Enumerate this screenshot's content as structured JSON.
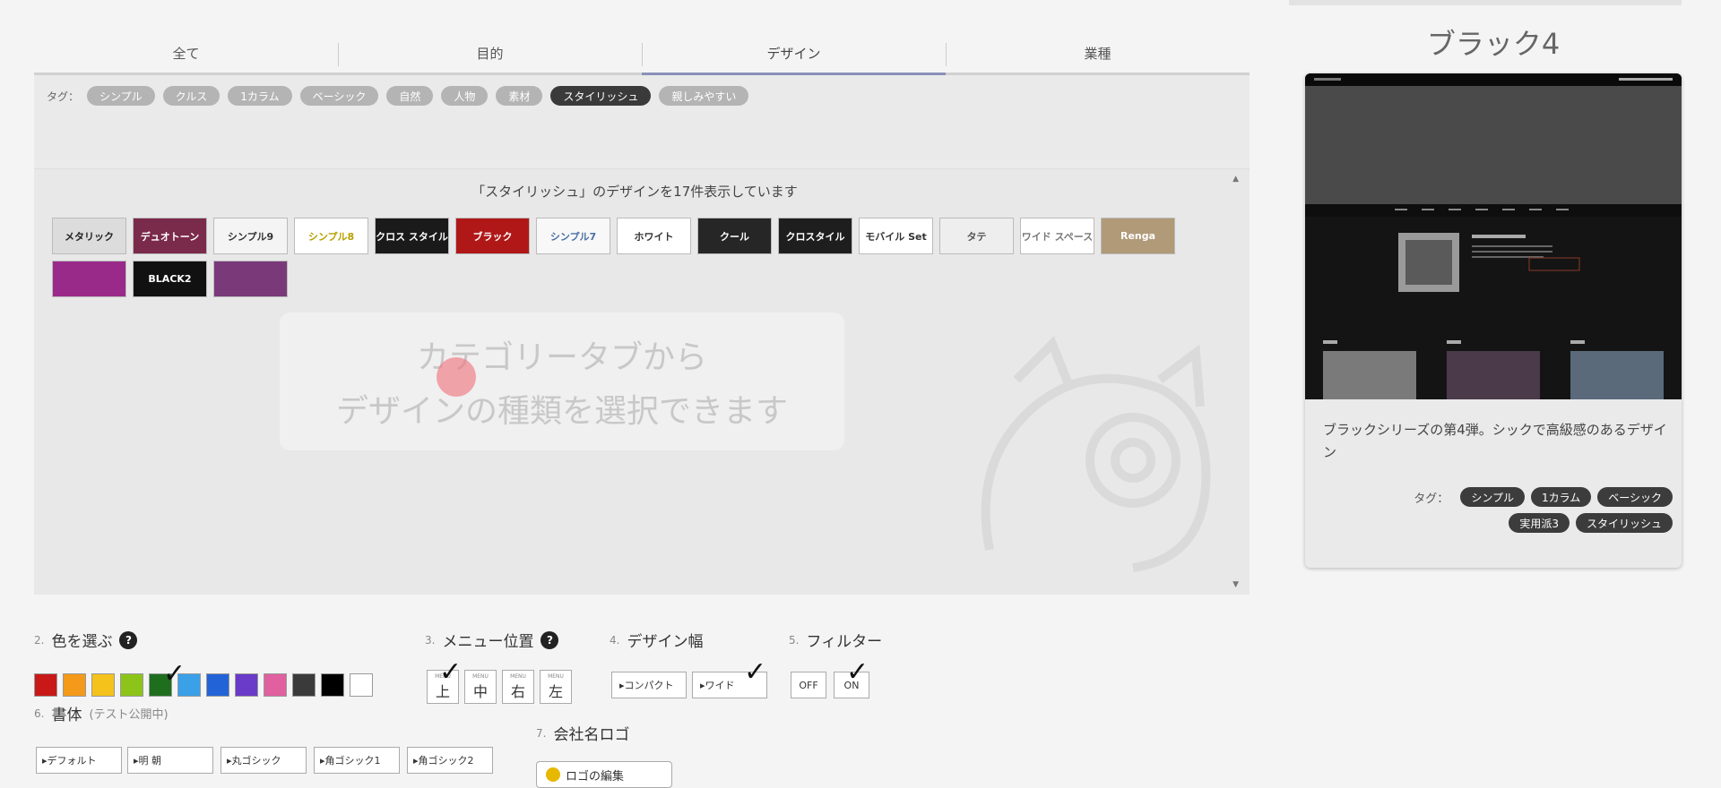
{
  "tabs": [
    {
      "label": "全て"
    },
    {
      "label": "目的"
    },
    {
      "label": "デザイン"
    },
    {
      "label": "業種"
    }
  ],
  "tagbar": {
    "label": "タグ：",
    "tags": [
      "シンプル",
      "クルス",
      "1カラム",
      "ベーシック",
      "自然",
      "人物",
      "素材",
      "スタイリッシュ",
      "親しみやすい"
    ],
    "active": "スタイリッシュ"
  },
  "gallery": {
    "count_text": "「スタイリッシュ」のデザインを17件表示しています",
    "thumbnails": [
      {
        "label": "メタリック",
        "bg": "#dcdcdc",
        "fg": "#222"
      },
      {
        "label": "デュオトーン",
        "bg": "#7a2a4a",
        "fg": "#fff"
      },
      {
        "label": "シンプル9",
        "bg": "#f4f4f4",
        "fg": "#333"
      },
      {
        "label": "シンプル8",
        "bg": "#ffffff",
        "fg": "#b8a000"
      },
      {
        "label": "クロス スタイル",
        "bg": "#1a1a1a",
        "fg": "#fff"
      },
      {
        "label": "ブラック",
        "bg": "#b01818",
        "fg": "#fff"
      },
      {
        "label": "シンプル7",
        "bg": "#f8f8f8",
        "fg": "#4a6fa5"
      },
      {
        "label": "ホワイト",
        "bg": "#ffffff",
        "fg": "#333"
      },
      {
        "label": "クール",
        "bg": "#262626",
        "fg": "#fff"
      },
      {
        "label": "クロスタイル",
        "bg": "#1e1e1e",
        "fg": "#fff"
      },
      {
        "label": "モバイル Set",
        "bg": "#ffffff",
        "fg": "#333"
      },
      {
        "label": "タテ",
        "bg": "#eeeeee",
        "fg": "#555"
      },
      {
        "label": "ワイド スペース",
        "bg": "#ffffff",
        "fg": "#777"
      },
      {
        "label": "Renga",
        "bg": "#b09a78",
        "fg": "#fff"
      },
      {
        "label": "",
        "bg": "#9a2a8a",
        "fg": "#fff"
      },
      {
        "label": "BLACK2",
        "bg": "#111111",
        "fg": "#fff"
      },
      {
        "label": "",
        "bg": "#7a3a7a",
        "fg": "#fff"
      }
    ],
    "hint_line1": "カテゴリータブから",
    "hint_line2": "デザインの種類を選択できます"
  },
  "preview": {
    "title": "ブラック4",
    "description": "ブラックシリーズの第4弾。シックで高級感のあるデザイン",
    "tags_label": "タグ：",
    "tags": [
      "シンプル",
      "1カラム",
      "ベーシック",
      "実用派3",
      "スタイリッシュ"
    ]
  },
  "options": {
    "color": {
      "num": "2.",
      "title": "色を選ぶ",
      "help": "?"
    },
    "colors": [
      "#c81818",
      "#f39a1a",
      "#f4c21a",
      "#8cc41a",
      "#1e6e1e",
      "#3aa0e8",
      "#2264d8",
      "#6a3ac8",
      "#e060a0",
      "#3a3a3a",
      "#000000",
      "#ffffff"
    ],
    "menu": {
      "num": "3.",
      "title": "メニュー位置",
      "help": "?",
      "buttons": [
        {
          "top": "上",
          "small": "MENU"
        },
        {
          "top": "中",
          "small": "MENU"
        },
        {
          "top": "右",
          "small": "MENU"
        },
        {
          "top": "左",
          "small": "MENU"
        }
      ]
    },
    "width": {
      "num": "4.",
      "title": "デザイン幅",
      "buttons": [
        "▸コンパクト",
        "▸ワイド"
      ]
    },
    "filter": {
      "num": "5.",
      "title": "フィルター",
      "buttons": [
        "OFF",
        "ON"
      ]
    },
    "font": {
      "num": "6.",
      "title": "書体",
      "note": "(テスト公開中)",
      "buttons": [
        "▸デフォルト",
        "▸明 朝",
        "▸丸ゴシック",
        "▸角ゴシック1",
        "▸角ゴシック2"
      ]
    },
    "logo": {
      "num": "7.",
      "title": "会社名ロゴ",
      "button": "ロゴの編集"
    },
    "check_mark": "✓"
  }
}
